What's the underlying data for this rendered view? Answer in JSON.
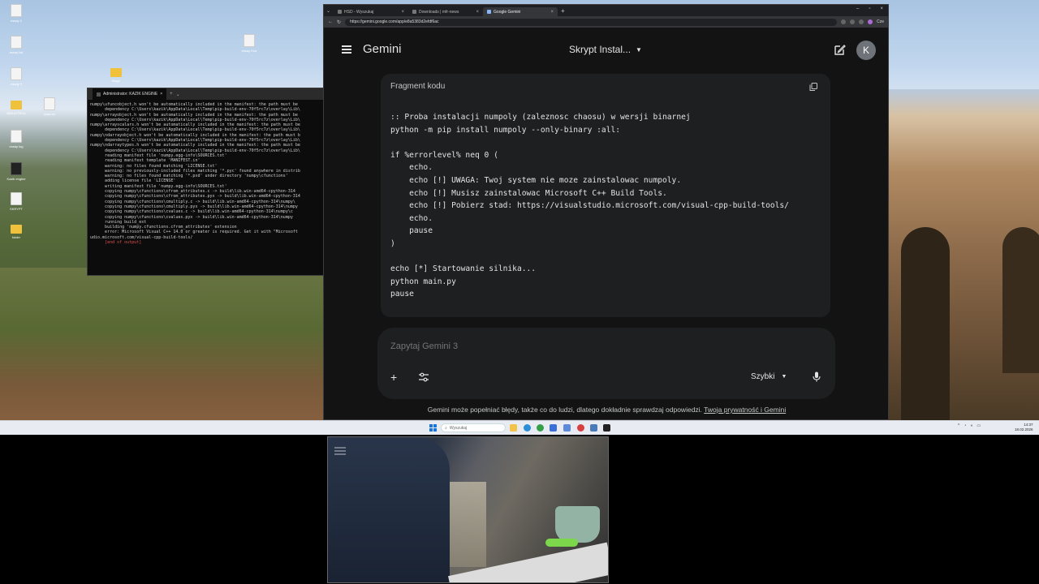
{
  "desktop": {
    "icons": [
      {
        "label": "essay 2",
        "kind": "doc"
      },
      {
        "label": "essay list",
        "kind": "doc"
      },
      {
        "label": "essay 3",
        "kind": "doc"
      },
      {
        "label": "essay Kod",
        "kind": "doc"
      },
      {
        "label": "Magic",
        "kind": "folder"
      },
      {
        "label": "BIBLIOTEKA",
        "kind": "folder"
      },
      {
        "label": "pass.txt",
        "kind": "doc"
      },
      {
        "label": "essay log",
        "kind": "doc"
      },
      {
        "label": "Kazik engine",
        "kind": "dark"
      },
      {
        "label": "SKRYPT",
        "kind": "doc"
      },
      {
        "label": "folder",
        "kind": "folder"
      }
    ]
  },
  "terminal": {
    "tab_title": "Administrator: KAZIK ENGINE",
    "lines": [
      "numpy\\ufuncobject.h won't be automatically included in the manifest: the path must be",
      "      dependency C:\\Users\\kazik\\AppData\\Local\\Temp\\pip-build-env-70f5rc7z\\overlay\\Lib\\",
      "numpy\\arrayobject.h won't be automatically included in the manifest: the path must be",
      "      dependency C:\\Users\\kazik\\AppData\\Local\\Temp\\pip-build-env-70f5rc7z\\overlay\\Lib\\",
      "numpy\\arrayscalars.h won't be automatically included in the manifest: the path must be",
      "      dependency C:\\Users\\kazik\\AppData\\Local\\Temp\\pip-build-env-70f5rc7z\\overlay\\Lib\\",
      "numpy\\ndarrayobject.h won't be automatically included in the manifest: the path must b",
      "      dependency C:\\Users\\kazik\\AppData\\Local\\Temp\\pip-build-env-70f5rc7z\\overlay\\Lib\\",
      "numpy\\ndarraytypes.h won't be automatically included in the manifest: the path must be",
      "      dependency C:\\Users\\kazik\\AppData\\Local\\Temp\\pip-build-env-70f5rc7z\\overlay\\Lib\\",
      "      reading manifest file 'numpy.egg-info\\SOURCES.txt'",
      "      reading manifest template 'MANIFEST.in'",
      "      warning: no files found matching 'LICENSE.txt'",
      "      warning: no previously-included files matching '*.pyc' found anywhere in distrib",
      "      warning: no files found matching '*.pxd' under directory 'numpy\\cfunctions'",
      "      adding license file 'LICENSE'",
      "      writing manifest file 'numpy.egg-info\\SOURCES.txt'",
      "      copying numpy\\cfunctions\\cfrom_attributes.c -> build\\lib.win-amd64-cpython-314",
      "      copying numpy\\cfunctions\\cfrom_attributes.pyx -> build\\lib.win-amd64-cpython-314",
      "      copying numpy\\cfunctions\\cmultiply.c -> build\\lib.win-amd64-cpython-314\\numpy\\",
      "      copying numpy\\cfunctions\\cmultiply.pyx -> build\\lib.win-amd64-cpython-314\\numpy",
      "      copying numpy\\cfunctions\\cvalues.c -> build\\lib.win-amd64-cpython-314\\numpy\\c",
      "      copying numpy\\cfunctions\\cvalues.pyx -> build\\lib.win-amd64-cpython-314\\numpy",
      "      running build_ext",
      "      building 'numpy.cfunctions.cfrom_attributes' extension",
      "      error: Microsoft Visual C++ 14.0 or greater is required. Get it with \"Microsoft",
      "udio.microsoft.com/visual-cpp-build-tools/"
    ],
    "end_line": "[end of output]"
  },
  "browser": {
    "tabs": [
      {
        "label": "HSD - Wyszukaj",
        "active": false
      },
      {
        "label": "Downloads | mfr-news",
        "active": false
      },
      {
        "label": "Google Gemini",
        "active": true
      }
    ],
    "new_tab": "+",
    "url": "https://gemini.google.com/app/e8a5383d2efdf6ac",
    "profile_label": "Cze"
  },
  "gemini": {
    "app_title": "Gemini",
    "chat_title": "Skrypt Instal...",
    "avatar_letter": "K",
    "code_label": "Fragment kodu",
    "code_lines": [
      ":: Proba instalacji numpoly (zaleznosc chaosu) w wersji binarnej",
      "python -m pip install numpoly --only-binary :all:",
      "",
      "if %errorlevel% neq 0 (",
      "    echo.",
      "    echo [!] UWAGA: Twoj system nie moze zainstalowac numpoly.",
      "    echo [!] Musisz zainstalowac Microsoft C++ Build Tools.",
      "    echo [!] Pobierz stad: https://visualstudio.microsoft.com/visual-cpp-build-tools/",
      "    echo.",
      "    pause",
      ")",
      "",
      "echo [*] Startowanie silnika...",
      "python main.py",
      "pause"
    ],
    "prompt_placeholder": "Zapytaj Gemini 3",
    "mode_label": "Szybki",
    "disclaimer": "Gemini może popełniać błędy, także co do ludzi, dlatego dokładnie sprawdzaj odpowiedzi.",
    "disclaimer_link": "Twoja prywatność i Gemini"
  },
  "taskbar": {
    "search_placeholder": "Wyszukaj",
    "clock_time": "14:37",
    "clock_date": "18.02.2026",
    "apps": [
      "file-explorer",
      "edge",
      "chrome",
      "store",
      "mail",
      "discord",
      "settings",
      "notepad",
      "terminal"
    ]
  },
  "colors": {
    "gemini_bg": "#131314",
    "card_bg": "#1e1f20",
    "text": "#e3e3e3",
    "accent_start": "#1a73d8",
    "terminal_error": "#e05050"
  }
}
